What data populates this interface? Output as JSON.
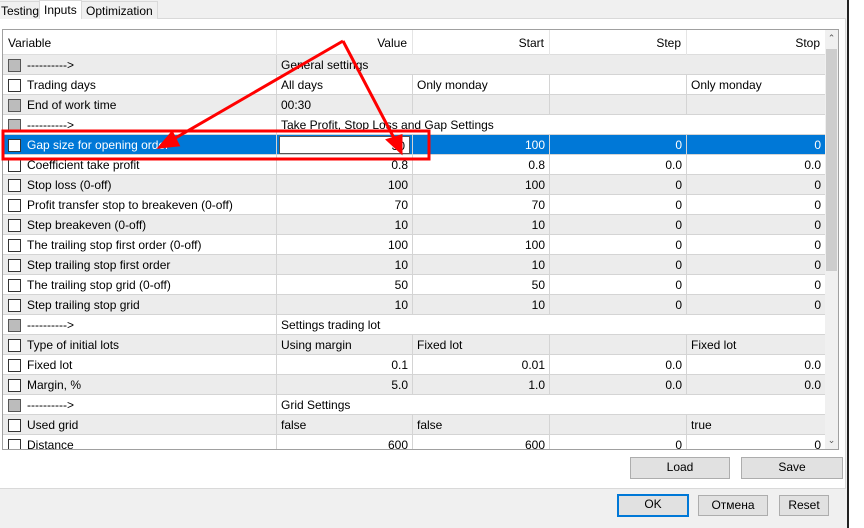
{
  "tabs": [
    {
      "label": "Testing"
    },
    {
      "label": "Inputs",
      "active": true
    },
    {
      "label": "Optimization"
    }
  ],
  "columns": [
    "Variable",
    "Value",
    "Start",
    "Step",
    "Stop"
  ],
  "rows": [
    {
      "name": "---------->",
      "group": "General settings",
      "checkbox": "gray"
    },
    {
      "name": "Trading days",
      "value": "All days",
      "start": "Only monday",
      "step": "",
      "stop": "Only monday",
      "checkbox": "empty",
      "text": true
    },
    {
      "name": "End of work time",
      "value": "00:30",
      "start": "",
      "step": "",
      "stop": "",
      "checkbox": "gray",
      "text": true
    },
    {
      "name": "---------->",
      "group": "Take Profit, Stop Loss and Gap Settings",
      "checkbox": "gray"
    },
    {
      "name": "Gap size for opening order",
      "value": "30",
      "start": "100",
      "step": "0",
      "stop": "0",
      "checkbox": "empty",
      "selected": true
    },
    {
      "name": "Coefficient take profit",
      "value": "0.8",
      "start": "0.8",
      "step": "0.0",
      "stop": "0.0",
      "checkbox": "empty"
    },
    {
      "name": "Stop loss (0-off)",
      "value": "100",
      "start": "100",
      "step": "0",
      "stop": "0",
      "checkbox": "empty"
    },
    {
      "name": "Profit transfer stop to breakeven  (0-off)",
      "value": "70",
      "start": "70",
      "step": "0",
      "stop": "0",
      "checkbox": "empty"
    },
    {
      "name": "Step breakeven (0-off)",
      "value": "10",
      "start": "10",
      "step": "0",
      "stop": "0",
      "checkbox": "empty"
    },
    {
      "name": "The trailing stop first order (0-off)",
      "value": "100",
      "start": "100",
      "step": "0",
      "stop": "0",
      "checkbox": "empty"
    },
    {
      "name": "Step trailing stop first order",
      "value": "10",
      "start": "10",
      "step": "0",
      "stop": "0",
      "checkbox": "empty"
    },
    {
      "name": "The trailing stop grid (0-off)",
      "value": "50",
      "start": "50",
      "step": "0",
      "stop": "0",
      "checkbox": "empty"
    },
    {
      "name": "Step trailing stop grid",
      "value": "10",
      "start": "10",
      "step": "0",
      "stop": "0",
      "checkbox": "empty"
    },
    {
      "name": "---------->",
      "group": "Settings trading lot",
      "checkbox": "gray"
    },
    {
      "name": "Type of initial lots",
      "value": "Using margin",
      "start": "Fixed lot",
      "step": "",
      "stop": "Fixed lot",
      "checkbox": "empty",
      "text": true
    },
    {
      "name": "Fixed lot",
      "value": "0.1",
      "start": "0.01",
      "step": "0.0",
      "stop": "0.0",
      "checkbox": "empty"
    },
    {
      "name": "Margin, %",
      "value": "5.0",
      "start": "1.0",
      "step": "0.0",
      "stop": "0.0",
      "checkbox": "empty"
    },
    {
      "name": "---------->",
      "group": "Grid Settings",
      "checkbox": "gray"
    },
    {
      "name": "Used grid",
      "value": "false",
      "start": "false",
      "step": "",
      "stop": "true",
      "checkbox": "empty",
      "text": true
    },
    {
      "name": "Distance",
      "value": "600",
      "start": "600",
      "step": "0",
      "stop": "0",
      "checkbox": "empty"
    }
  ],
  "buttons": {
    "load": "Load",
    "save": "Save",
    "ok": "OK",
    "cancel": "Отмена",
    "reset": "Reset"
  },
  "colors": {
    "selection": "#0078d7",
    "annotation": "#ff0000"
  },
  "icons": {
    "scroll_up": "chevron-up-icon",
    "scroll_down": "chevron-down-icon"
  }
}
